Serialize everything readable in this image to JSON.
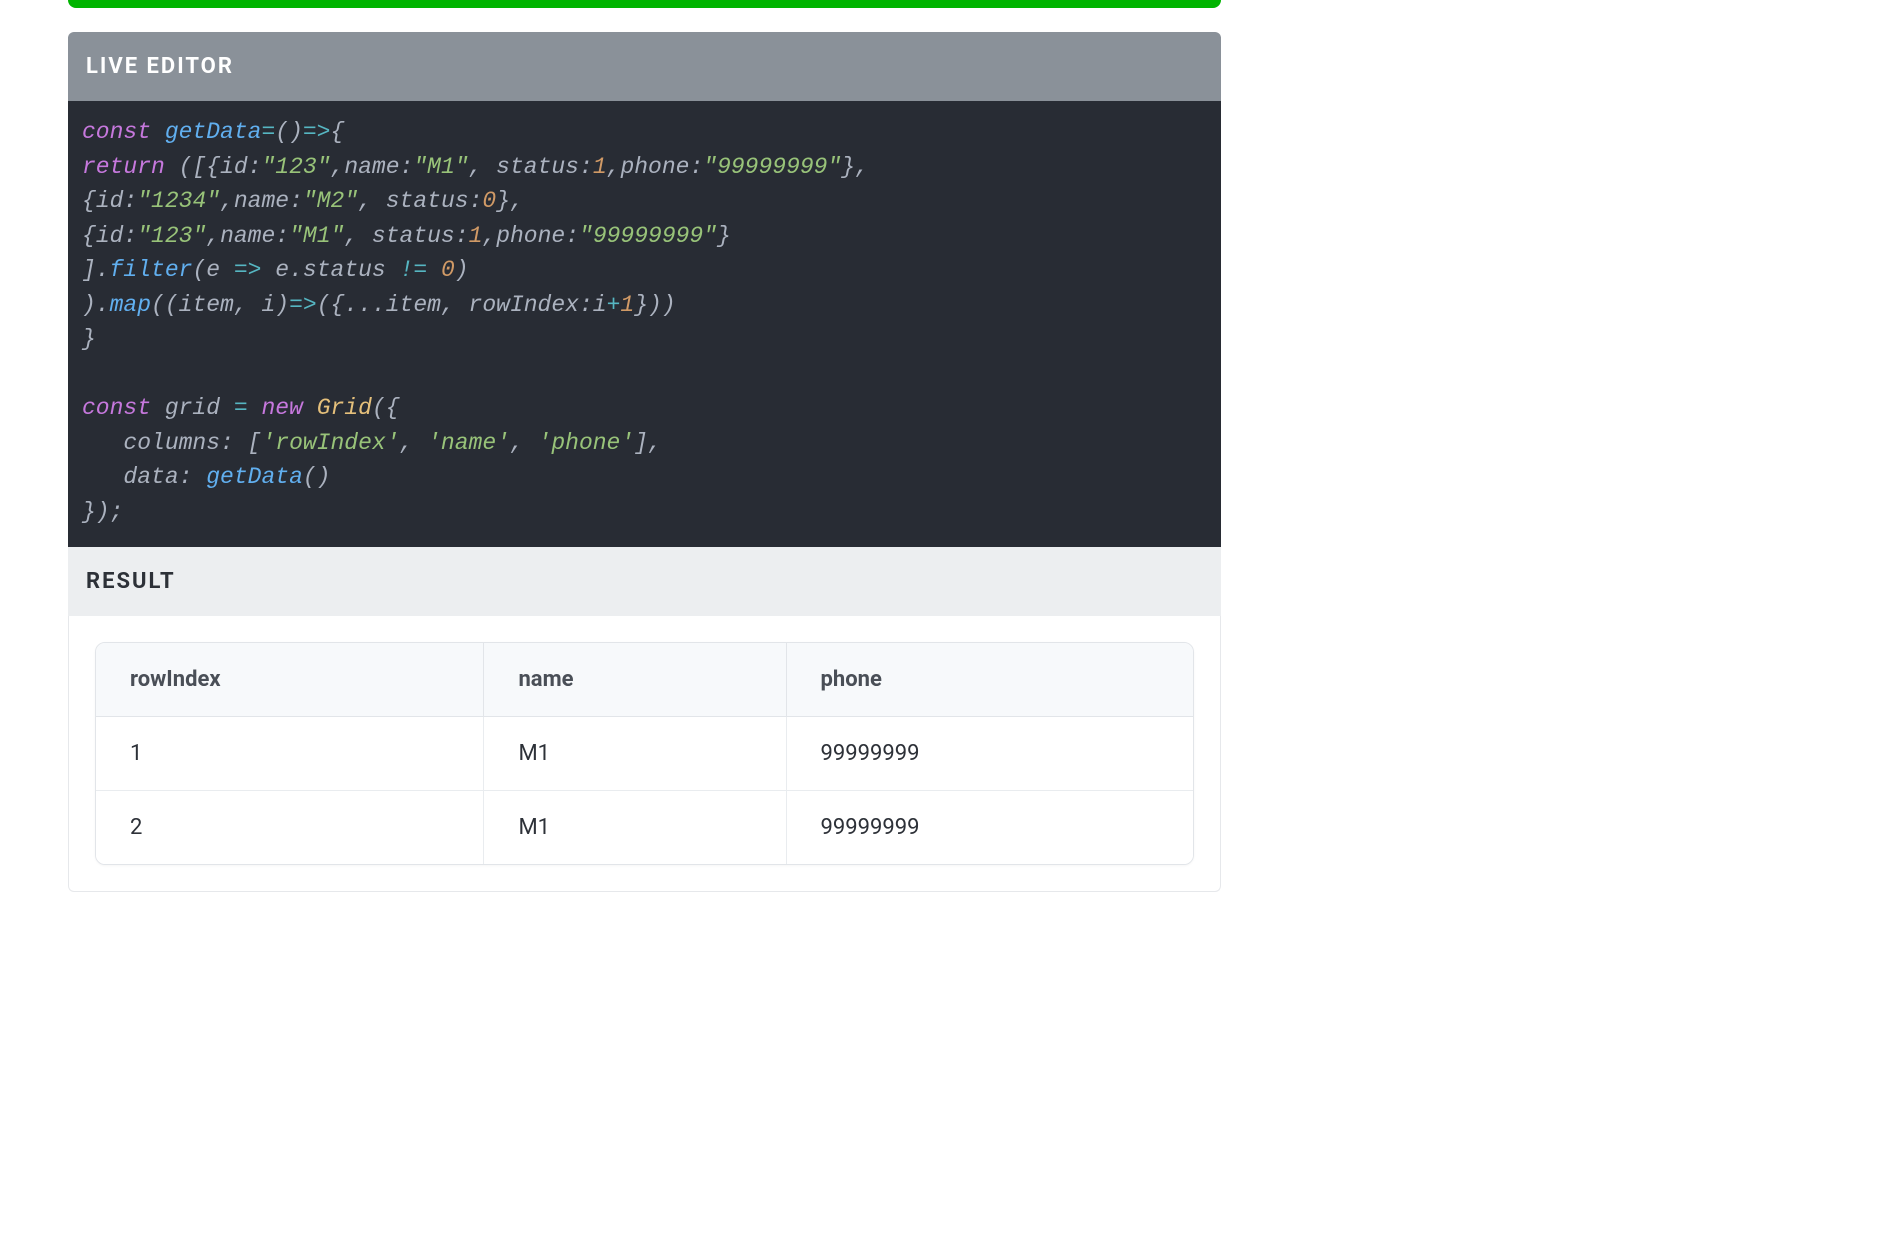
{
  "green_bar": true,
  "editor": {
    "header": "LIVE EDITOR",
    "code_plain": "const getData=()=>{\nreturn ([{id:\"123\",name:\"M1\", status:1,phone:\"99999999\"},\n{id:\"1234\",name:\"M2\", status:0},\n{id:\"123\",name:\"M1\", status:1,phone:\"99999999\"}\n].filter(e => e.status != 0)\n).map((item, i)=>({...item, rowIndex:i+1}))\n}\n\nconst grid = new Grid({\n   columns: ['rowIndex', 'name', 'phone'],\n   data: getData()\n});"
  },
  "result": {
    "header": "RESULT",
    "columns": [
      "rowIndex",
      "name",
      "phone"
    ],
    "rows": [
      {
        "rowIndex": "1",
        "name": "M1",
        "phone": "99999999"
      },
      {
        "rowIndex": "2",
        "name": "M1",
        "phone": "99999999"
      }
    ]
  }
}
